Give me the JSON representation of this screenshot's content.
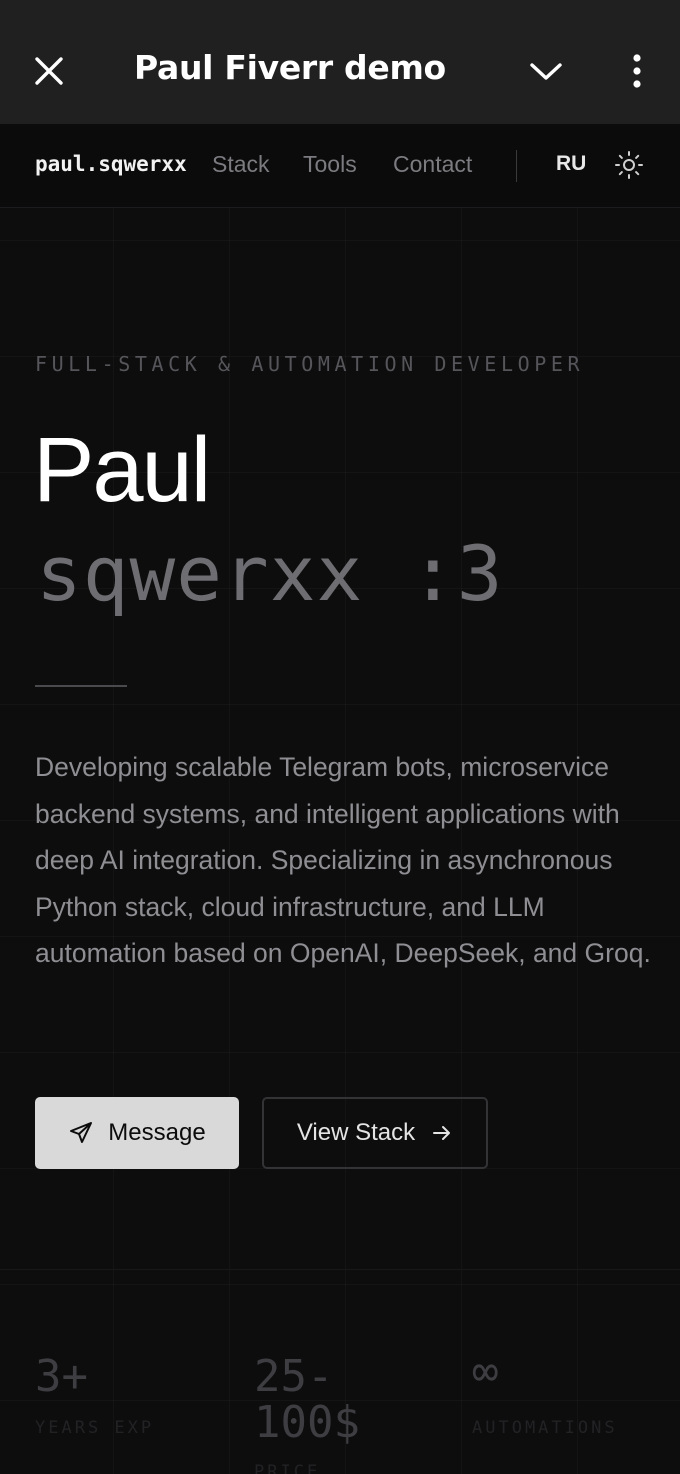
{
  "appbar": {
    "title": "Paul Fiverr demo"
  },
  "nav": {
    "brand": "paul.sqwerxx",
    "links": [
      "Stack",
      "Tools",
      "Contact"
    ],
    "lang": "RU"
  },
  "hero": {
    "kicker": "FULL-STACK & AUTOMATION DEVELOPER",
    "name_first": "Paul",
    "name_second": "sqwerxx :3",
    "description": "Developing scalable Telegram bots, microservice backend systems, and intelligent applications with deep AI integration. Specializing in asynchronous Python stack, cloud infrastructure, and LLM automation based on OpenAI, DeepSeek, and Groq.",
    "btn_message": "Message",
    "btn_stack": "View Stack"
  },
  "stats": [
    {
      "value": "3+",
      "label": "YEARS EXP"
    },
    {
      "value": "25-\n100$",
      "label": "PRICE"
    },
    {
      "value": "∞",
      "label": "AUTOMATIONS"
    }
  ]
}
